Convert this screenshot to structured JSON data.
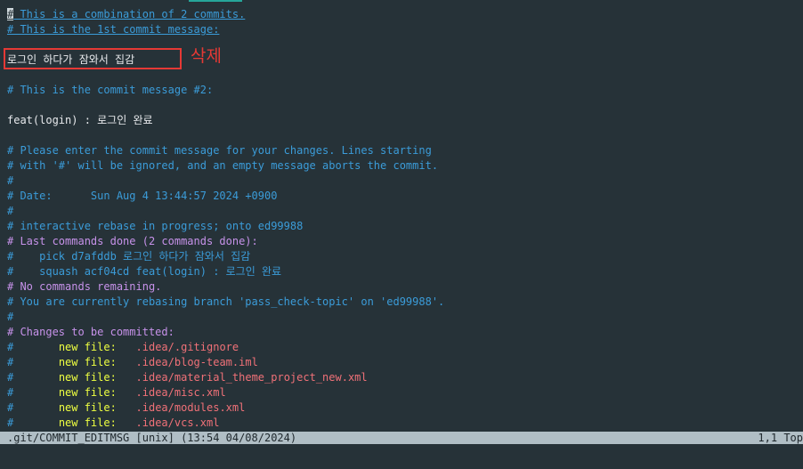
{
  "editor": {
    "line1_cursor": "#",
    "line1_rest": " This is a combination of 2 commits.",
    "line2": "# This is the 1st commit message:",
    "line3": "로그인 하다가 잠와서 집감",
    "line4": "# This is the commit message #2:",
    "line5": "feat(login) : 로그인 완료",
    "line6": "# Please enter the commit message for your changes. Lines starting",
    "line7": "# with '#' will be ignored, and an empty message aborts the commit.",
    "line8": "#",
    "line9_label": "# Date:",
    "line9_value": "      Sun Aug 4 13:44:57 2024 +0900",
    "line10": "#",
    "line11": "# interactive rebase in progress; onto ed99988",
    "line12_label": "# Last commands done (2 commands done):",
    "line13": "#    pick d7afddb 로그인 하다가 잠와서 집감",
    "line14": "#    squash acf04cd feat(login) : 로그인 완료",
    "line15": "# No commands remaining.",
    "line16": "# You are currently rebasing branch 'pass_check-topic' on 'ed99988'.",
    "line17": "#",
    "line18": "# Changes to be committed:",
    "changes": [
      {
        "prefix": "#",
        "status": "new file:",
        "path": ".idea/.gitignore"
      },
      {
        "prefix": "#",
        "status": "new file:",
        "path": ".idea/blog-team.iml"
      },
      {
        "prefix": "#",
        "status": "new file:",
        "path": ".idea/material_theme_project_new.xml"
      },
      {
        "prefix": "#",
        "status": "new file:",
        "path": ".idea/misc.xml"
      },
      {
        "prefix": "#",
        "status": "new file:",
        "path": ".idea/modules.xml"
      },
      {
        "prefix": "#",
        "status": "new file:",
        "path": ".idea/vcs.xml"
      }
    ]
  },
  "annotation": {
    "label": "삭제",
    "color": "#e53935"
  },
  "statusbar": {
    "left": ".git/COMMIT_EDITMSG [unix] (13:54 04/08/2024)",
    "right": "1,1 Top"
  }
}
